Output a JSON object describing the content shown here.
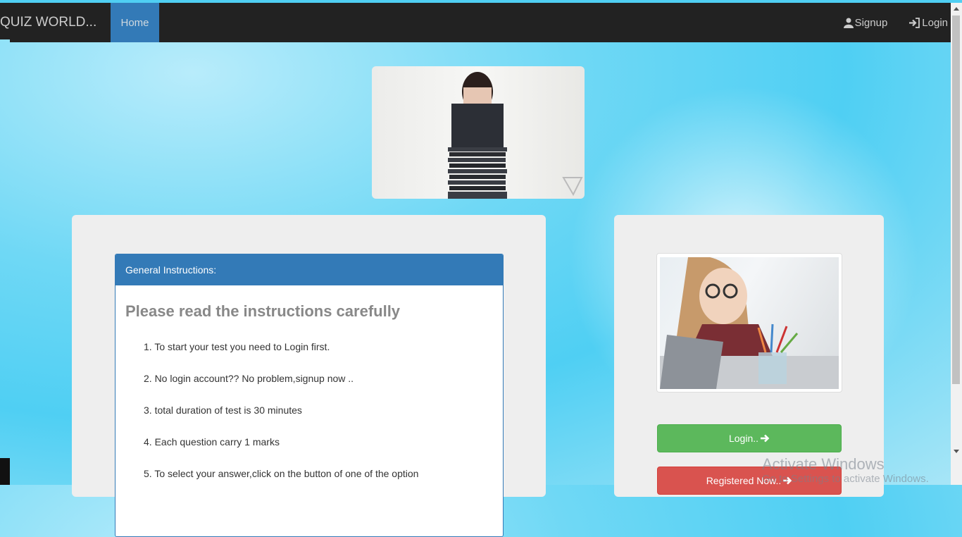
{
  "navbar": {
    "brand": "QUIZ WORLD...",
    "home": "Home",
    "signup": "Signup",
    "login": "Login"
  },
  "instructions": {
    "header": "General Instructions:",
    "title": "Please read the instructions carefully",
    "items": [
      "1. To start your test you need to Login first.",
      "2. No login account?? No problem,signup now ..",
      "3. total duration of test is 30 minutes",
      "4. Each question carry 1 marks",
      "5. To select your answer,click on the button of one of the option"
    ]
  },
  "side": {
    "login_button": "Login..",
    "register_button": "Registered Now.."
  },
  "watermark": {
    "line1": "Activate Windows",
    "line2": "Go to Settings to activate Windows."
  },
  "colors": {
    "navbar": "#222222",
    "primary": "#337ab7",
    "success": "#5cb85c",
    "danger": "#d9534f"
  }
}
